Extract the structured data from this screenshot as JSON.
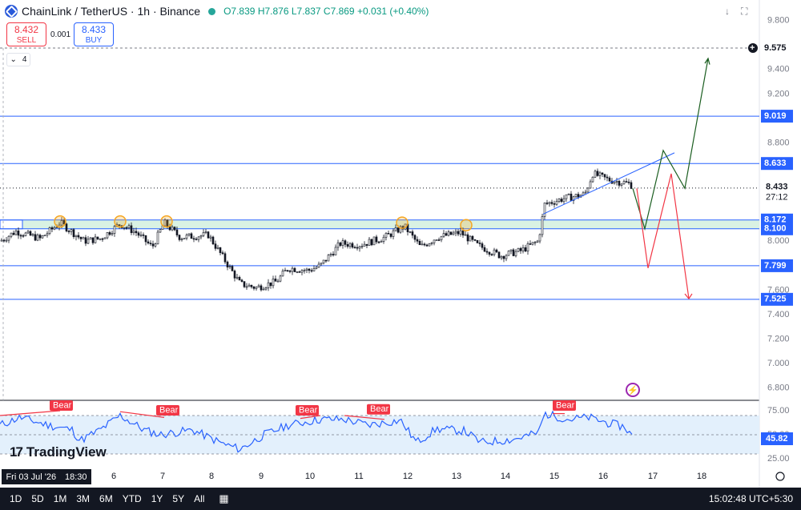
{
  "header": {
    "symbol": "ChainLink / TetherUS · 1h · Binance",
    "open": "O7.839",
    "high": "H7.876",
    "low": "L7.837",
    "close": "C7.869",
    "change": "+0.031 (+0.40%)"
  },
  "trade": {
    "sell_price": "8.432",
    "sell_label": "SELL",
    "spread": "0.001",
    "buy_price": "8.433",
    "buy_label": "BUY"
  },
  "indicator_toggle": {
    "count": "4"
  },
  "brand": {
    "name": "TradingView"
  },
  "crosshair": {
    "date": "Fri 03 Jul '26",
    "time": "18:30"
  },
  "price_scale": {
    "ticks": [
      "9.800",
      "9.400",
      "9.200",
      "8.800",
      "8.400",
      "8.000",
      "7.600",
      "7.400",
      "7.200",
      "7.000",
      "6.800"
    ],
    "marker_price": "9.575",
    "levels": [
      "9.019",
      "8.633",
      "8.172",
      "8.100",
      "7.799",
      "7.525"
    ],
    "last_price": "8.433",
    "countdown": "27:12"
  },
  "rsi": {
    "ticks": [
      "75.00",
      "50.00",
      "25.00"
    ],
    "value": "45.82",
    "divergence_label": "Bear"
  },
  "time_axis": {
    "labels": [
      "6",
      "7",
      "8",
      "9",
      "10",
      "11",
      "12",
      "13",
      "14",
      "15",
      "16",
      "17",
      "18"
    ]
  },
  "bottom_bar": {
    "ranges": [
      "1D",
      "5D",
      "1M",
      "3M",
      "6M",
      "YTD",
      "1Y",
      "5Y",
      "All"
    ],
    "clock": "15:02:48 UTC+5:30"
  },
  "colors": {
    "level_line": "#2962ff",
    "up": "#131722",
    "down": "#131722",
    "bullish_path": "#1b5e20",
    "bearish_path": "#f23645",
    "zone_fill": "#d9f2e3",
    "marker_circle": "#f5a623",
    "rsi_line": "#2962ff",
    "rsi_fill": "#e3f0fc"
  },
  "icons": [
    "chevron-down-icon",
    "fullscreen-icon",
    "plus-circle-icon",
    "flash-icon",
    "calendar-icon",
    "settings-icon"
  ]
}
